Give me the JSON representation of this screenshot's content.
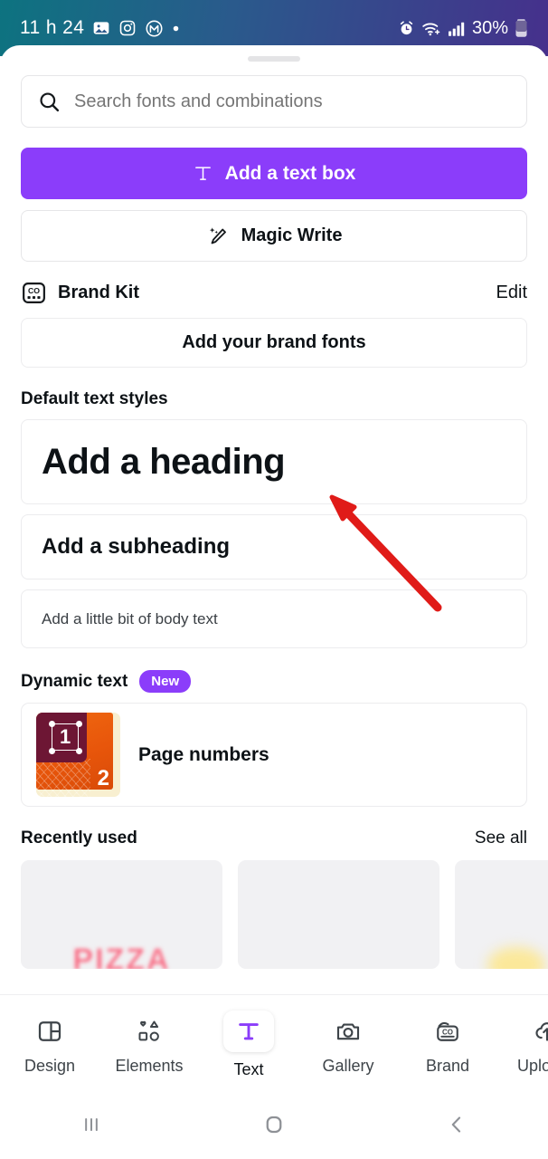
{
  "status_bar": {
    "time": "11 h 24",
    "battery_percent": "30%",
    "left_icons": [
      "photo-icon",
      "instagram-icon",
      "circled-m-icon",
      "dot-indicator"
    ],
    "right_icons": [
      "alarm-icon",
      "wifi-icon",
      "signal-bars-icon",
      "battery-icon"
    ],
    "gradient_from": "#0D7380",
    "gradient_to": "#46308C"
  },
  "search": {
    "placeholder": "Search fonts and combinations",
    "icon": "search-icon"
  },
  "actions": {
    "add_text_box": "Add a text box",
    "add_text_box_icon": "text-t-icon",
    "magic_write": "Magic Write",
    "magic_write_icon": "magic-pencil-icon",
    "primary_color": "#8B3DFA"
  },
  "brand_kit": {
    "title": "Brand Kit",
    "icon": "brand-co-icon",
    "edit_label": "Edit",
    "add_fonts_label": "Add your brand fonts"
  },
  "default_text_styles": {
    "section_label": "Default text styles",
    "items": [
      {
        "label": "Add a heading",
        "style": "heading"
      },
      {
        "label": "Add a subheading",
        "style": "subheading"
      },
      {
        "label": "Add a little bit of body text",
        "style": "body"
      }
    ]
  },
  "dynamic_text": {
    "section_label": "Dynamic text",
    "badge": "New",
    "badge_color": "#8B3DFA",
    "items": [
      {
        "label": "Page numbers",
        "thumb_number_top": "1",
        "thumb_number_bottom": "2"
      }
    ]
  },
  "recently_used": {
    "section_label": "Recently used",
    "see_all_label": "See all",
    "thumbnails": [
      {
        "caption": "PIZZA"
      },
      {
        "caption": ""
      },
      {
        "caption": ""
      }
    ]
  },
  "bottom_nav": {
    "items": [
      {
        "label": "Design",
        "icon": "layout-panels-icon",
        "active": false
      },
      {
        "label": "Elements",
        "icon": "shapes-icon",
        "active": false
      },
      {
        "label": "Text",
        "icon": "text-t-icon",
        "active": true
      },
      {
        "label": "Gallery",
        "icon": "camera-icon",
        "active": false
      },
      {
        "label": "Brand",
        "icon": "brand-co-icon",
        "active": false
      },
      {
        "label": "Uploads",
        "icon": "upload-cloud-icon",
        "active": false
      }
    ],
    "active_color": "#8B3DFA"
  },
  "android_nav": {
    "items": [
      {
        "icon": "recents-icon"
      },
      {
        "icon": "home-icon"
      },
      {
        "icon": "back-icon"
      }
    ]
  },
  "annotation": {
    "arrow_color": "#E01B18",
    "points_to": "Add a heading"
  }
}
